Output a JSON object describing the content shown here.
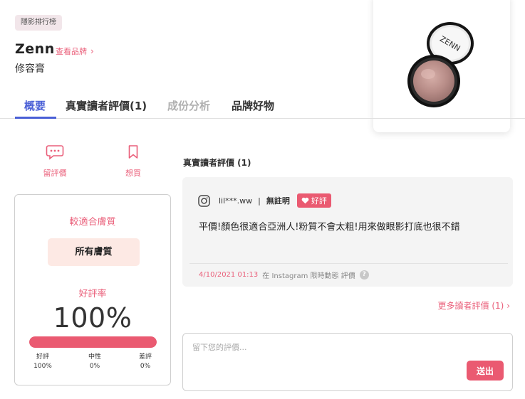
{
  "header": {
    "category_badge": "隱影排行榜",
    "brand": "Zenn",
    "brand_link": "查看品牌",
    "product_name": "修容膏"
  },
  "product_image": {
    "alt": "ZENN compact",
    "logo_text": "ZENN"
  },
  "tabs": [
    {
      "label": "概要",
      "state": "active"
    },
    {
      "label": "真實讀者評價(1)",
      "state": "normal"
    },
    {
      "label": "成份分析",
      "state": "disabled"
    },
    {
      "label": "品牌好物",
      "state": "normal"
    }
  ],
  "actions": {
    "review": {
      "label": "留評價",
      "icon": "chat-bubble-icon"
    },
    "want": {
      "label": "想買",
      "icon": "bookmark-icon"
    }
  },
  "stats": {
    "skin_fit_title": "較適合膚質",
    "skin_fit_value": "所有膚質",
    "rating_title": "好評率",
    "rating_value": "100%",
    "positive_fraction": 1.0,
    "breakdown": [
      {
        "label": "好評",
        "value": "100%"
      },
      {
        "label": "中性",
        "value": "0%"
      },
      {
        "label": "差評",
        "value": "0%"
      }
    ]
  },
  "reviews": {
    "section_title": "真實讀者評價 (1)",
    "items": [
      {
        "user": "lil***.ww",
        "separator": "|",
        "tag": "無註明",
        "badge": "好評",
        "text": "平價!顏色很適合亞洲人!粉質不會太粗!用來做眼影打底也很不錯",
        "date": "4/10/2021 01:13",
        "source": "在 Instagram 限時動態 評價",
        "help": "?"
      }
    ],
    "more_link": "更多讀者評價 (1)",
    "more_chevron": "›"
  },
  "comment": {
    "placeholder": "留下您的評價...",
    "submit_label": "送出"
  },
  "colors": {
    "accent_pink": "#ea5a71",
    "active_tab_blue": "#4a5fd6",
    "fit_pill_bg": "#fde9e4"
  }
}
